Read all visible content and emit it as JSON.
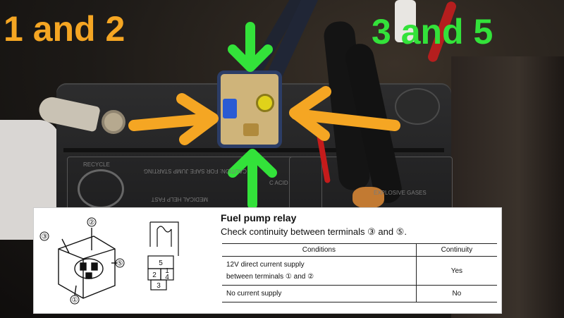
{
  "overlay_labels": {
    "left": "1 and 2",
    "right": "3 and 5"
  },
  "colors": {
    "orange": "#f5a623",
    "green": "#33e23a"
  },
  "manual": {
    "title": "Fuel pump relay",
    "instruction": "Check continuity between terminals ③ and ⑤.",
    "table": {
      "headers": [
        "Conditions",
        "Continuity"
      ],
      "rows": [
        {
          "condition_line1": "12V direct current supply",
          "condition_line2": "between terminals ① and ②",
          "continuity": "Yes"
        },
        {
          "condition_line1": "No current supply",
          "condition_line2": "",
          "continuity": "No"
        }
      ]
    },
    "diagram": {
      "terminal_labels": [
        "①",
        "②",
        "③",
        "⑤"
      ],
      "schematic_numbers": [
        "5",
        "2",
        "1",
        "4",
        "3"
      ]
    }
  },
  "battery_text": [
    "RECYCLE",
    "CAUTION: FOR SAFE JUMP STARTING",
    "MEDICAL HELP FAST",
    "C ACID",
    "EXPLOSIVE GASES"
  ]
}
